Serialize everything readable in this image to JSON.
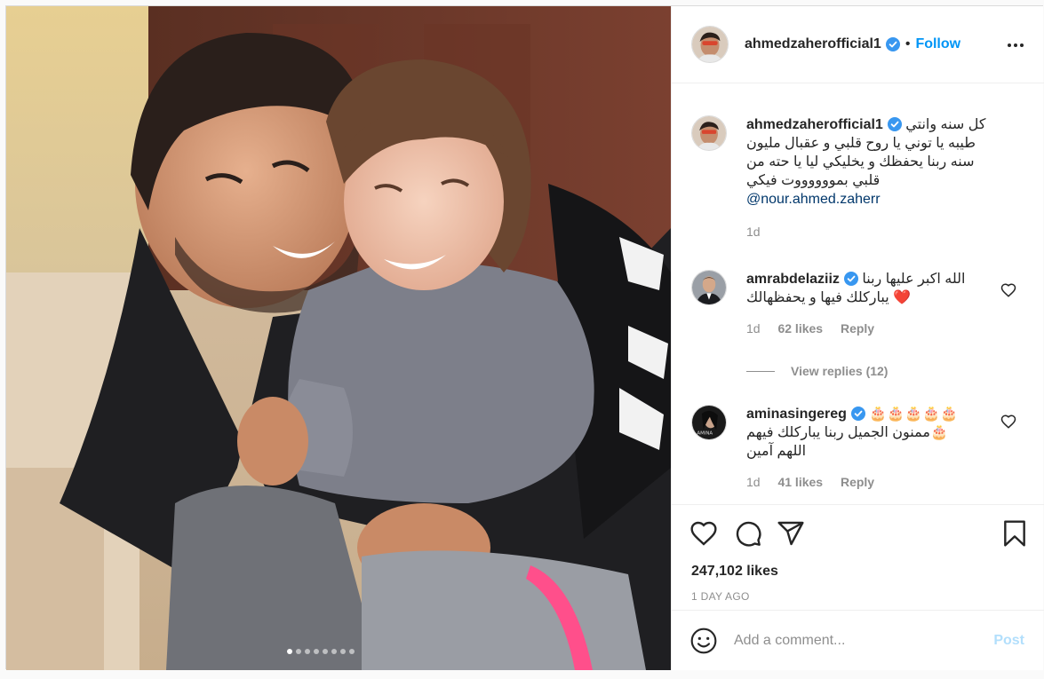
{
  "post": {
    "author": "ahmedzaherofficial1",
    "follow_label": "Follow",
    "separator": "•",
    "caption_lines": [
      "كل سنه وانتي",
      "طيبه يا توني يا روح قلبي و عقبال مليون",
      "سنه ربنا يحفظك و يخليكي ليا يا حته من",
      "قلبي بمووووووت فيكي"
    ],
    "mention": "@nour.ahmed.zaherr",
    "caption_age": "1d",
    "likes": "247,102 likes",
    "date": "1 DAY AGO",
    "photo_dots": 8,
    "active_dot": 0
  },
  "comments": [
    {
      "username": "amrabdelaziiz",
      "line1": "الله اكبر عليها ربنا",
      "line2": "يباركلك فيها و يحفظهالك",
      "emoji": "❤️",
      "age": "1d",
      "likes": "62 likes",
      "reply": "Reply",
      "view_replies": "View replies (12)"
    },
    {
      "username": "aminasingereg",
      "emoji_run": "🎂🎂🎂🎂🎂",
      "line1_emoji": "🎂",
      "line1": "ممنون الجميل ربنا يباركلك فيهم",
      "line2": "اللهم آمين",
      "age": "1d",
      "likes": "41 likes",
      "reply": "Reply"
    }
  ],
  "composer": {
    "placeholder": "Add a comment...",
    "post_label": "Post"
  },
  "icons": [
    "verified-badge-icon",
    "more-options-icon",
    "heart-icon",
    "comment-icon",
    "share-icon",
    "bookmark-icon",
    "emoji-icon"
  ],
  "colors": {
    "link": "#0095f6",
    "post_disabled": "#b2dffc",
    "muted": "#8e8e8e",
    "text": "#262626"
  }
}
